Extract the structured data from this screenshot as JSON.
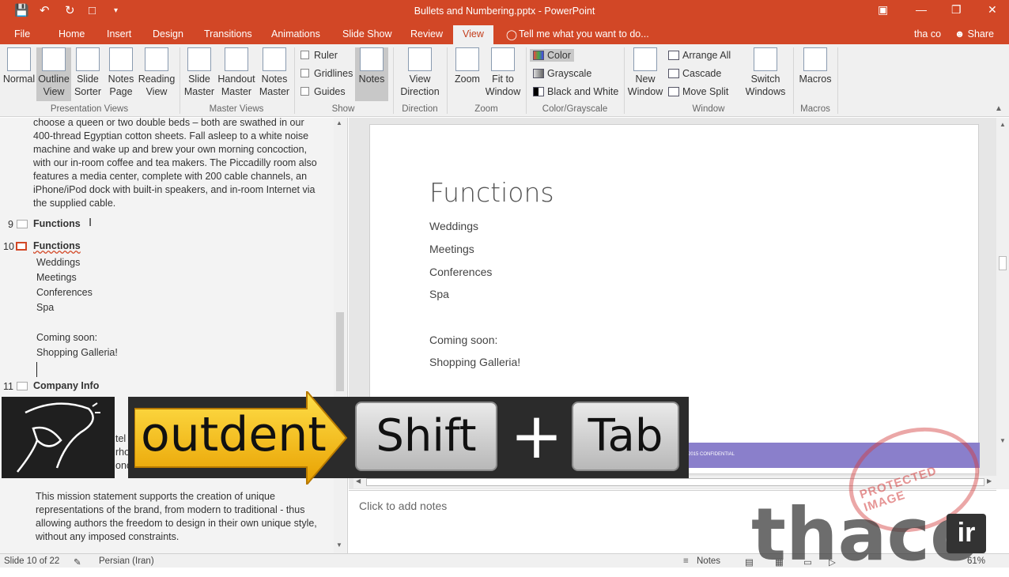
{
  "window": {
    "title": "Bullets and Numbering.pptx - PowerPoint",
    "user": "tha co",
    "share": "Share",
    "tell_me": "Tell me what you want to do..."
  },
  "tabs": [
    "File",
    "Home",
    "Insert",
    "Design",
    "Transitions",
    "Animations",
    "Slide Show",
    "Review",
    "View"
  ],
  "active_tab": "View",
  "ribbon": {
    "presentation_views": {
      "label": "Presentation Views",
      "buttons": [
        "Normal",
        "Outline View",
        "Slide Sorter",
        "Notes Page",
        "Reading View"
      ]
    },
    "master_views": {
      "label": "Master Views",
      "buttons": [
        "Slide Master",
        "Handout Master",
        "Notes Master"
      ]
    },
    "show": {
      "label": "Show",
      "checks": [
        "Ruler",
        "Gridlines",
        "Guides"
      ],
      "notes": "Notes"
    },
    "direction": {
      "label": "Direction",
      "button": "View Direction"
    },
    "zoom": {
      "label": "Zoom",
      "buttons": [
        "Zoom",
        "Fit to Window"
      ]
    },
    "color": {
      "label": "Color/Grayscale",
      "buttons": [
        "Color",
        "Grayscale",
        "Black and White"
      ]
    },
    "window": {
      "label": "Window",
      "new_window": "New Window",
      "small": [
        "Arrange All",
        "Cascade",
        "Move Split"
      ],
      "switch": "Switch Windows"
    },
    "macros": {
      "label": "Macros",
      "button": "Macros"
    }
  },
  "outline": {
    "top_text": [
      "choose a queen or two double beds – both are swathed in our",
      "400-thread Egyptian cotton sheets. Fall asleep to a white noise",
      "machine and wake up and brew your own morning concoction,",
      "with our in-room coffee and tea makers. The Piccadilly room also",
      "features a media center, complete with 200 cable channels, an",
      "iPhone/iPod dock with built-in speakers, and in-room Internet via",
      "the supplied cable."
    ],
    "slide9": {
      "num": "9",
      "title": "Functions"
    },
    "slide10": {
      "num": "10",
      "title": "Functions",
      "items": [
        "Weddings",
        "Meetings",
        "Conferences",
        "Spa",
        "",
        "Coming soon:",
        "Shopping Galleria!"
      ]
    },
    "slide11": {
      "num": "11",
      "title": "Company Info"
    },
    "partial": [
      "tel",
      "rho",
      "onc"
    ],
    "bottom_text": [
      "This mission statement supports the creation of unique",
      "representations of the brand, from modern to traditional - thus",
      "allowing authors the freedom to design in their own unique style,",
      "without any imposed constraints."
    ]
  },
  "slide": {
    "title": "Functions",
    "lines": [
      "Weddings",
      "Meetings",
      "Conferences",
      "Spa",
      "",
      "Coming soon:",
      "Shopping Galleria!"
    ],
    "footer": "2015 CONFIDENTIAL"
  },
  "notes_placeholder": "Click to add notes",
  "status": {
    "slide": "Slide 10 of 22",
    "language": "Persian (Iran)",
    "notes": "Notes",
    "zoom": "61%"
  },
  "overlay": {
    "word": "outdent",
    "key1": "Shift",
    "plus": "+",
    "key2": "Tab"
  },
  "watermark": {
    "text": "thaco",
    "tld": "ir",
    "stamp": "PROTECTED IMAGE"
  }
}
